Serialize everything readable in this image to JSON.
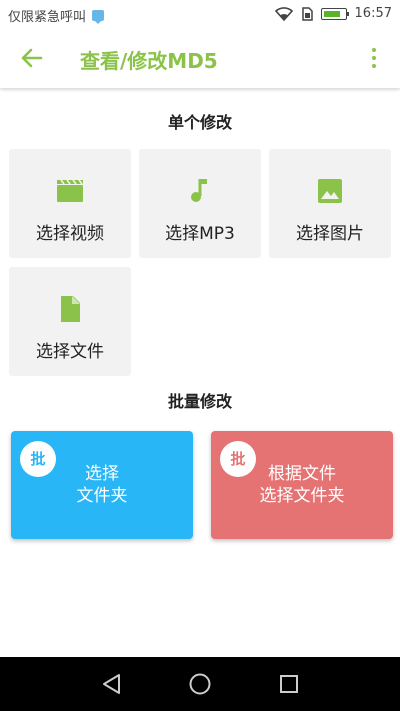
{
  "status_bar": {
    "carrier_text": "仅限紧急呼叫",
    "time": "16:57"
  },
  "app_bar": {
    "title": "查看/修改MD5"
  },
  "single": {
    "title": "单个修改",
    "tiles": [
      {
        "label": "选择视频",
        "icon": "video-clapper-icon"
      },
      {
        "label": "选择MP3",
        "icon": "music-note-icon"
      },
      {
        "label": "选择图片",
        "icon": "image-icon"
      },
      {
        "label": "选择文件",
        "icon": "file-icon"
      }
    ]
  },
  "batch": {
    "title": "批量修改",
    "cards": [
      {
        "badge": "批",
        "line1": "选择",
        "line2": "文件夹",
        "color": "#29b6f6"
      },
      {
        "badge": "批",
        "line1": "根据文件",
        "line2": "选择文件夹",
        "color": "#e57373"
      }
    ]
  },
  "colors": {
    "accent": "#8bc34a",
    "tile_bg": "#f2f2f2"
  }
}
